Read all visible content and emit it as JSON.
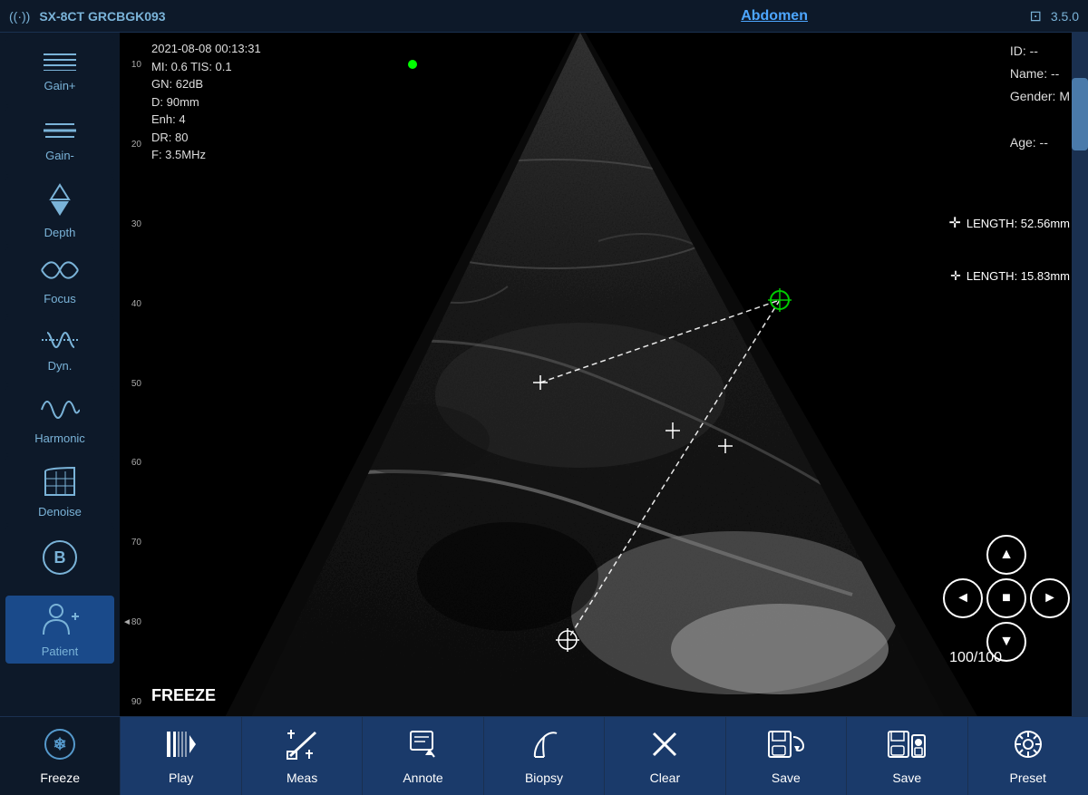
{
  "topbar": {
    "signal_icon": "((·))",
    "device": "SX-8CT GRCBGK093",
    "exam_type": "Abdomen",
    "wifi_icon": "⊡",
    "version": "3.5.0"
  },
  "sidebar": {
    "items": [
      {
        "id": "gain-plus",
        "label": "Gain+",
        "icon": "≡"
      },
      {
        "id": "gain-minus",
        "label": "Gain-",
        "icon": "≡"
      },
      {
        "id": "depth",
        "label": "Depth",
        "icon": "⇅"
      },
      {
        "id": "focus",
        "label": "Focus",
        "icon": "⋈"
      },
      {
        "id": "dyn",
        "label": "Dyn.",
        "icon": "∿"
      },
      {
        "id": "harmonic",
        "label": "Harmonic",
        "icon": "∿"
      },
      {
        "id": "denoise",
        "label": "Denoise",
        "icon": "▦"
      },
      {
        "id": "b-mode",
        "label": "B",
        "icon": ""
      },
      {
        "id": "patient",
        "label": "Patient",
        "icon": "👤"
      }
    ]
  },
  "scan_info": {
    "datetime": "2021-08-08 00:13:31",
    "mi": "MI: 0.6  TIS: 0.1",
    "gn": "GN: 62dB",
    "depth": "D: 90mm",
    "enh": "Enh: 4",
    "dr": "DR: 80",
    "freq": "F: 3.5MHz"
  },
  "patient_info": {
    "id": "ID: --",
    "name": "Name: --",
    "gender": "Gender: M",
    "age": "Age: --"
  },
  "measurements": {
    "length1_label": "LENGTH: 52.56mm",
    "length2_label": "LENGTH: 15.83mm"
  },
  "depth_scale": {
    "labels": [
      "10",
      "20",
      "30",
      "40",
      "50",
      "60",
      "70",
      "80",
      "90"
    ]
  },
  "overlay": {
    "freeze_text": "FREEZE",
    "frame_counter": "100/100"
  },
  "toolbar": {
    "freeze_label": "Freeze",
    "play_label": "Play",
    "meas_label": "Meas",
    "annote_label": "Annote",
    "biopsy_label": "Biopsy",
    "clear_label": "Clear",
    "save1_label": "Save",
    "save2_label": "Save",
    "preset_label": "Preset"
  }
}
